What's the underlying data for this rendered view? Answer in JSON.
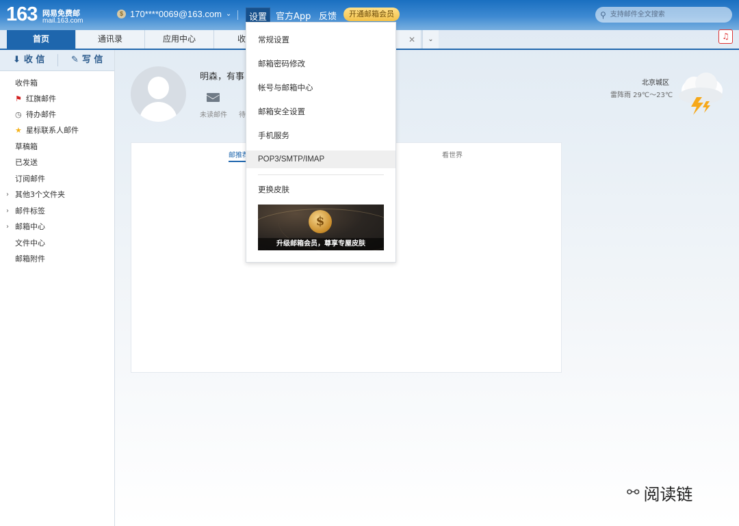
{
  "header": {
    "logo_num": "163",
    "logo_cn": "网易免费邮",
    "logo_url": "mail.163.com",
    "account": "170****0069@163.com",
    "nav": {
      "settings": "设置",
      "app": "官方App",
      "feedback": "反馈"
    },
    "vip_button": "开通邮箱会员",
    "search_placeholder": "支持邮件全文搜索"
  },
  "tabs": [
    {
      "label": "首页",
      "active": true
    },
    {
      "label": "通讯录"
    },
    {
      "label": "应用中心"
    },
    {
      "label": "收"
    }
  ],
  "sidebar": {
    "receive": "收 信",
    "compose": "写 信",
    "items": [
      {
        "label": "收件箱"
      },
      {
        "label": "红旗邮件",
        "icon": "red-flag-icon"
      },
      {
        "label": "待办邮件",
        "icon": "clock-icon"
      },
      {
        "label": "星标联系人邮件",
        "icon": "star-icon"
      },
      {
        "label": "草稿箱"
      },
      {
        "label": "已发送"
      },
      {
        "label": "订阅邮件"
      },
      {
        "label": "其他3个文件夹",
        "expandable": true
      },
      {
        "label": "邮件标签",
        "expandable": true
      },
      {
        "label": "邮箱中心",
        "expandable": true
      },
      {
        "label": "文件中心"
      },
      {
        "label": "邮箱附件"
      }
    ]
  },
  "main": {
    "greeting": "明森，有事",
    "stats": {
      "unread": "未读邮件",
      "todo": "待"
    },
    "weather": {
      "city": "北京城区",
      "temp": "雷阵雨 29℃～23℃"
    },
    "panel_tabs": {
      "recommend": "邮推荐",
      "world": "看世界"
    }
  },
  "settings_menu": {
    "items": [
      "常规设置",
      "邮箱密码修改",
      "帐号与邮箱中心",
      "邮箱安全设置",
      "手机服务",
      "POP3/SMTP/IMAP"
    ],
    "highlighted": "POP3/SMTP/IMAP",
    "skin": "更换皮肤",
    "banner_text": "升级邮箱会员，尊享专屋皮肤"
  },
  "watermark": "阅读链",
  "colors": {
    "brand_blue": "#1e66ad",
    "vip_gold": "#f3c24a",
    "flag_red": "#d21f1f",
    "star_yellow": "#f5b21b"
  }
}
